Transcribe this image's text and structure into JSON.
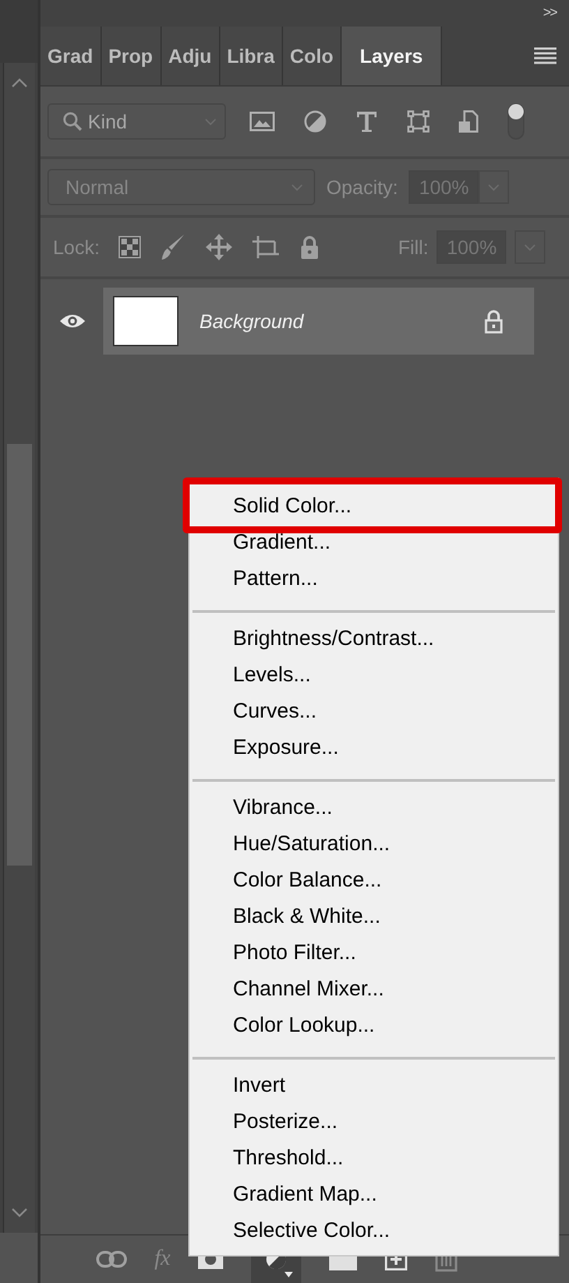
{
  "panel_header": {
    "collapse_label": ">>"
  },
  "tabs": [
    {
      "label": "Grad",
      "selected": false
    },
    {
      "label": "Prop",
      "selected": false
    },
    {
      "label": "Adju",
      "selected": false
    },
    {
      "label": "Libra",
      "selected": false
    },
    {
      "label": "Colo",
      "selected": false
    },
    {
      "label": "Layers",
      "selected": true
    }
  ],
  "filter": {
    "value": "Kind"
  },
  "blend_mode": {
    "value": "Normal"
  },
  "opacity": {
    "label": "Opacity:",
    "value": "100%"
  },
  "lock": {
    "label": "Lock:"
  },
  "fill": {
    "label": "Fill:",
    "value": "100%"
  },
  "layers": [
    {
      "name": "Background",
      "visible": true,
      "locked": true
    }
  ],
  "adjustment_menu": {
    "groups": [
      {
        "items": [
          {
            "label": "Solid Color...",
            "highlighted": true
          },
          {
            "label": "Gradient...",
            "highlighted": false
          },
          {
            "label": "Pattern...",
            "highlighted": false
          }
        ]
      },
      {
        "items": [
          {
            "label": "Brightness/Contrast...",
            "highlighted": false
          },
          {
            "label": "Levels...",
            "highlighted": false
          },
          {
            "label": "Curves...",
            "highlighted": false
          },
          {
            "label": "Exposure...",
            "highlighted": false
          }
        ]
      },
      {
        "items": [
          {
            "label": "Vibrance...",
            "highlighted": false
          },
          {
            "label": "Hue/Saturation...",
            "highlighted": false
          },
          {
            "label": "Color Balance...",
            "highlighted": false
          },
          {
            "label": "Black & White...",
            "highlighted": false
          },
          {
            "label": "Photo Filter...",
            "highlighted": false
          },
          {
            "label": "Channel Mixer...",
            "highlighted": false
          },
          {
            "label": "Color Lookup...",
            "highlighted": false
          }
        ]
      },
      {
        "items": [
          {
            "label": "Invert",
            "highlighted": false
          },
          {
            "label": "Posterize...",
            "highlighted": false
          },
          {
            "label": "Threshold...",
            "highlighted": false
          },
          {
            "label": "Gradient Map...",
            "highlighted": false
          },
          {
            "label": "Selective Color...",
            "highlighted": false
          }
        ]
      }
    ]
  },
  "bottom_toolbar": {
    "fx_label": "fx"
  }
}
